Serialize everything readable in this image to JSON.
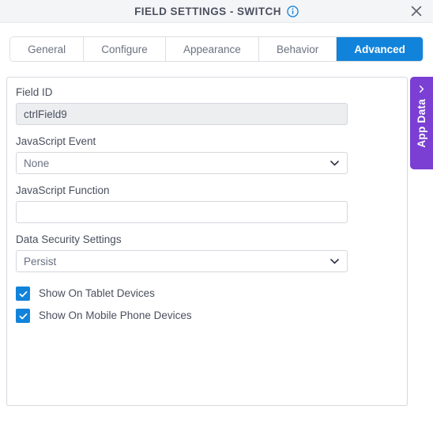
{
  "titlebar": {
    "title": "FIELD SETTINGS - SWITCH",
    "info_icon": "info-circle-icon",
    "close_icon": "close-icon"
  },
  "tabs": [
    {
      "label": "General",
      "active": false
    },
    {
      "label": "Configure",
      "active": false
    },
    {
      "label": "Appearance",
      "active": false
    },
    {
      "label": "Behavior",
      "active": false
    },
    {
      "label": "Advanced",
      "active": true
    }
  ],
  "form": {
    "field_id": {
      "label": "Field ID",
      "value": "ctrlField9",
      "placeholder": ""
    },
    "javascript_event": {
      "label": "JavaScript Event",
      "value": "None",
      "chevron_icon": "chevron-down-icon"
    },
    "javascript_function": {
      "label": "JavaScript Function",
      "value": "",
      "placeholder": ""
    },
    "data_security_settings": {
      "label": "Data Security Settings",
      "value": "Persist",
      "chevron_icon": "chevron-down-icon"
    },
    "checkboxes": [
      {
        "label": "Show On Tablet Devices",
        "checked": true
      },
      {
        "label": "Show On Mobile Phone Devices",
        "checked": true
      }
    ]
  },
  "app_data_panel": {
    "label": "App Data",
    "chevron_icon": "chevron-left-icon"
  },
  "colors": {
    "accent_blue": "#1283da",
    "app_data_purple": "#7b3fd4",
    "title_text": "#4c5160",
    "header_bg": "#f4f5f7"
  }
}
